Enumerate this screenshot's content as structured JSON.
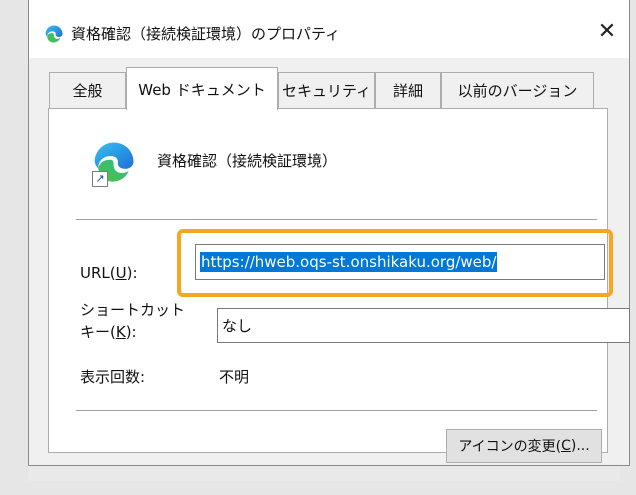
{
  "window": {
    "title": "資格確認（接続検証環境）のプロパティ",
    "close_glyph": "✕"
  },
  "tabs": [
    {
      "label": "全般",
      "active": false
    },
    {
      "label": "Web ドキュメント",
      "active": true
    },
    {
      "label": "セキュリティ",
      "active": false
    },
    {
      "label": "詳細",
      "active": false
    },
    {
      "label": "以前のバージョン",
      "active": false
    }
  ],
  "shortcut": {
    "name": "資格確認（接続検証環境）",
    "icon": "edge-icon"
  },
  "fields": {
    "url": {
      "label_prefix": "URL(",
      "label_key": "U",
      "label_suffix": "):",
      "value": "https://hweb.oqs-st.onshikaku.org/web/"
    },
    "shortcut_key": {
      "label_line1": "ショートカット",
      "label_prefix": "キー(",
      "label_key": "K",
      "label_suffix": "):",
      "value": "なし"
    },
    "visit_count": {
      "label": "表示回数:",
      "value": "不明"
    }
  },
  "buttons": {
    "change_icon_prefix": "アイコンの変更(",
    "change_icon_key": "C",
    "change_icon_suffix": ")..."
  },
  "colors": {
    "highlight": "#f5a623",
    "selection": "#0078d7"
  }
}
